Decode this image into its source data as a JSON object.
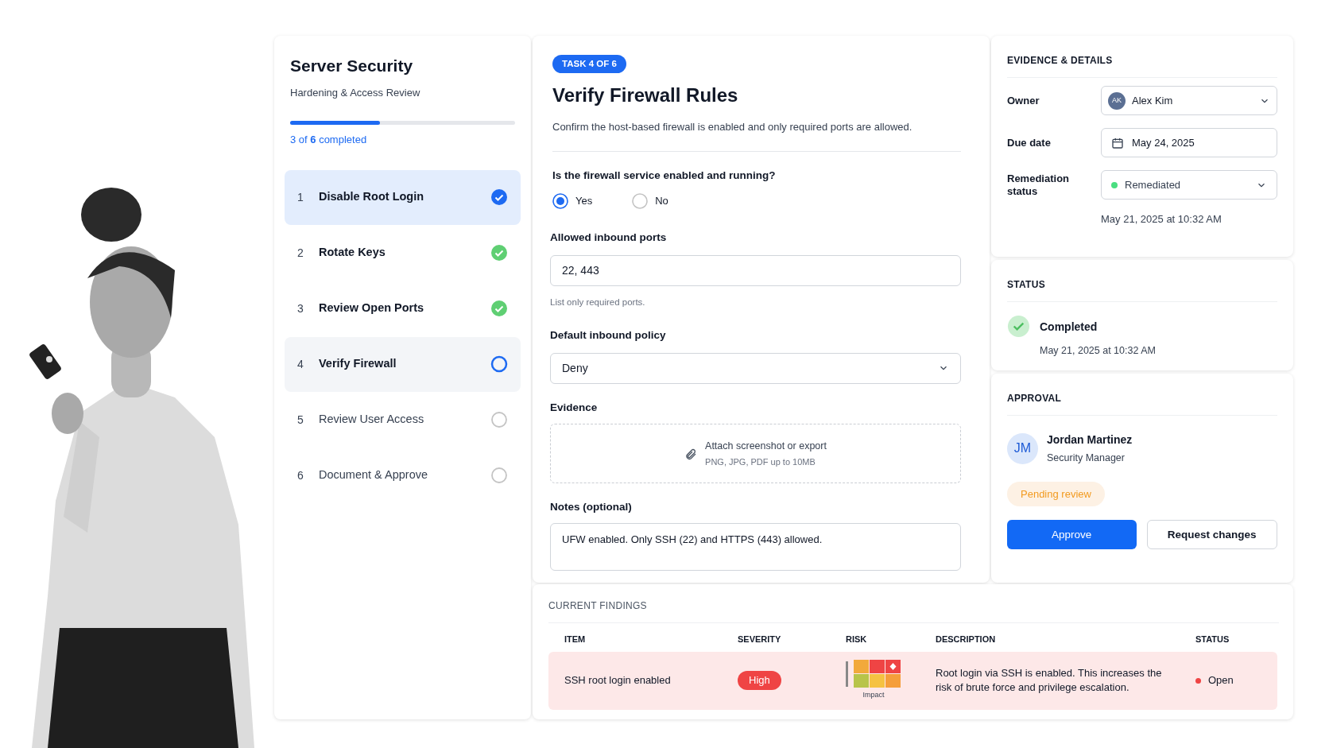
{
  "sidebar": {
    "title": "Server Security",
    "subtitle": "Hardening & Access Review",
    "progress": {
      "level": 0.4,
      "label": "3 of **6** completed"
    },
    "steps": [
      {
        "number": "1",
        "label": "Disable Root Login",
        "kind": "done",
        "selected": true
      },
      {
        "number": "2",
        "label": "Rotate Keys",
        "kind": "done",
        "selected": false
      },
      {
        "number": "3",
        "label": "Review Open Ports",
        "kind": "done",
        "selected": false
      },
      {
        "number": "4",
        "label": "Verify Firewall",
        "kind": "current",
        "selected": false
      },
      {
        "number": "5",
        "label": "Review User Access",
        "kind": "todo",
        "selected": false
      },
      {
        "number": "6",
        "label": "Document & Approve",
        "kind": "todo",
        "selected": false
      }
    ]
  },
  "task": {
    "badge": "TASK 4 OF 6",
    "title": "Verify Firewall Rules",
    "description": "Confirm the host-based firewall is enabled and only required ports are allowed.",
    "question": {
      "label": "Is the firewall service enabled and running?",
      "options": [
        {
          "label": "Yes",
          "selected": true
        },
        {
          "label": "No",
          "selected": false
        }
      ]
    },
    "ports": {
      "label": "Allowed inbound ports",
      "value": "22, 443",
      "hint": "List only required ports."
    },
    "policy": {
      "label": "Default inbound policy",
      "value": "Deny"
    },
    "evidence": {
      "label": "Evidence",
      "title": "Attach screenshot or export",
      "hint": "PNG, JPG, PDF up to 10MB"
    },
    "notes": {
      "label": "Notes (optional)",
      "value": "UFW enabled. Only SSH (22) and HTTPS (443) allowed."
    }
  },
  "details": {
    "heading": "EVIDENCE & DETAILS",
    "owner": {
      "label": "Owner",
      "initials": "AK",
      "value": "Alex Kim"
    },
    "due": {
      "label": "Due date",
      "value": "May 24, 2025"
    },
    "remediation": {
      "label": "Remediation status",
      "value": "Remediated",
      "color": "#4ade80"
    },
    "timestamp": "May 21, 2025 at 10:32 AM"
  },
  "status": {
    "heading": "STATUS",
    "value": "Completed",
    "timestamp": "May 21, 2025 at 10:32 AM"
  },
  "approval": {
    "heading": "APPROVAL",
    "initials": "JM",
    "name": "Jordan Martinez",
    "role": "Security Manager",
    "badge": "Pending review",
    "buttons": [
      {
        "label": "Approve",
        "kind": "primary"
      },
      {
        "label": "Request changes",
        "kind": "secondary"
      }
    ]
  },
  "findings": {
    "heading": "CURRENT FINDINGS",
    "columns": [
      "ITEM",
      "SEVERITY",
      "RISK",
      "DESCRIPTION",
      "STATUS"
    ],
    "rows": [
      {
        "item": "SSH root login enabled",
        "severity": {
          "label": "High",
          "color": "#ef4444"
        },
        "risk_label": "Impact",
        "description": "Root login via SSH is enabled. This increases the risk of brute force and privilege escalation.",
        "status": {
          "label": "Open",
          "color": "#ef4444"
        }
      }
    ]
  }
}
